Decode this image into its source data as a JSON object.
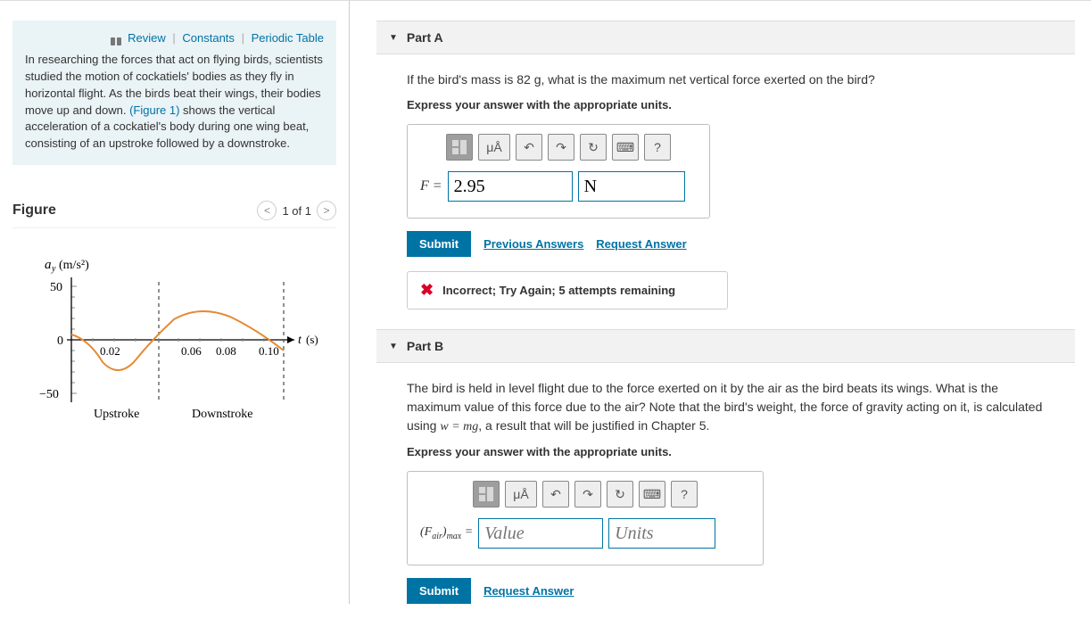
{
  "nav": {
    "review": "Review",
    "constants": "Constants",
    "periodic": "Periodic Table"
  },
  "problem_text": "In researching the forces that act on flying birds, scientists studied the motion of cockatiels' bodies as they fly in horizontal flight. As the birds beat their wings, their bodies move up and down. ",
  "figure_ref": "(Figure 1)",
  "problem_text2": " shows the vertical acceleration of a cockatiel's body during one wing beat, consisting of an upstroke followed by a downstroke.",
  "figure": {
    "title": "Figure",
    "pager": "1 of 1",
    "ylabel_var": "a",
    "ylabel_sub": "y",
    "ylabel_unit": " (m/s²)",
    "xlabel_var": "t",
    "xlabel_unit": " (s)",
    "upstroke": "Upstroke",
    "downstroke": "Downstroke",
    "yticks": [
      "50",
      "0",
      "−50"
    ],
    "xticks": [
      "0.02",
      "0.06",
      "0.08",
      "0.10"
    ]
  },
  "chart_data": {
    "type": "line",
    "title": "Vertical acceleration vs time",
    "xlabel": "t (s)",
    "ylabel": "a_y (m/s²)",
    "xlim": [
      0,
      0.1
    ],
    "ylim": [
      -50,
      50
    ],
    "x": [
      0.0,
      0.01,
      0.02,
      0.03,
      0.04,
      0.05,
      0.06,
      0.07,
      0.08,
      0.09,
      0.1
    ],
    "y": [
      5,
      -10,
      -28,
      -15,
      5,
      20,
      28,
      25,
      15,
      0,
      -10
    ],
    "regions": {
      "upstroke": [
        0,
        0.04
      ],
      "downstroke": [
        0.04,
        0.1
      ]
    }
  },
  "partA": {
    "title": "Part A",
    "question": "If the bird's mass is 82 g, what is the maximum net vertical force exerted on the bird?",
    "instruction": "Express your answer with the appropriate units.",
    "var_label": "F = ",
    "value": "2.95",
    "units": "N",
    "submit": "Submit",
    "prev": "Previous Answers",
    "req": "Request Answer",
    "feedback": "Incorrect; Try Again; 5 attempts remaining"
  },
  "partB": {
    "title": "Part B",
    "question_pre": "The bird is held in level flight due to the force exerted on it by the air as the bird beats its wings. What is the maximum value of this force due to the air? Note that the bird's weight, the force of gravity acting on it, is calculated using ",
    "question_eq": "w = mg",
    "question_post": ", a result that will be justified in Chapter 5.",
    "instruction": "Express your answer with the appropriate units.",
    "var_label": "(Fₐᵢᵣ)ₘₐₓ = ",
    "value_ph": "Value",
    "units_ph": "Units",
    "submit": "Submit",
    "req": "Request Answer"
  },
  "toolbar": {
    "templates": "templates",
    "symbols": "μÅ",
    "undo": "↶",
    "redo": "↷",
    "reset": "↻",
    "keyboard": "⌨",
    "help": "?"
  }
}
